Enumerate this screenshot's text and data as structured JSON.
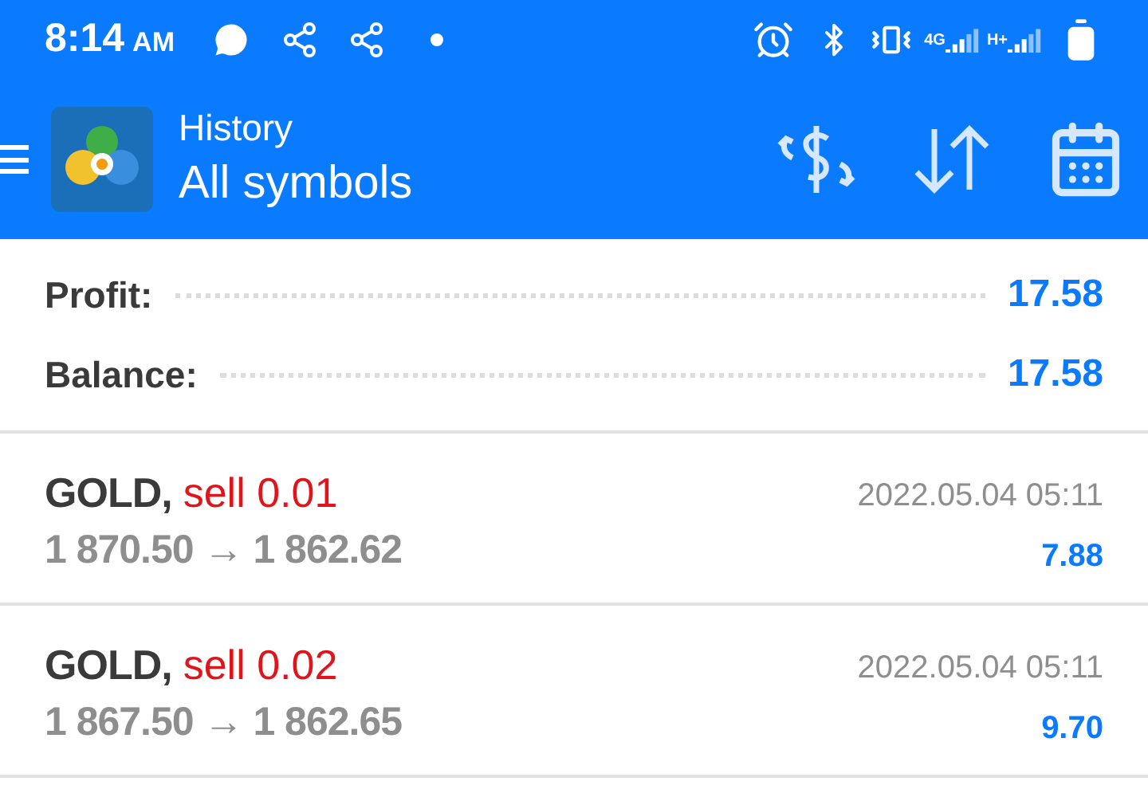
{
  "status_bar": {
    "time": "8:14",
    "ampm": "AM",
    "network_1": "4G",
    "network_2": "H+"
  },
  "header": {
    "title": "History",
    "subtitle": "All symbols"
  },
  "summary": [
    {
      "label": "Profit:",
      "value": "17.58"
    },
    {
      "label": "Balance:",
      "value": "17.58"
    }
  ],
  "deals": [
    {
      "symbol": "GOLD,",
      "kind": "sell",
      "action": "sell 0.01",
      "prices": "1 870.50 → 1 862.62",
      "time": "2022.05.04 05:11",
      "profit": "7.88"
    },
    {
      "symbol": "GOLD,",
      "kind": "sell",
      "action": "sell 0.02",
      "prices": "1 867.50 → 1 862.65",
      "time": "2022.05.04 05:11",
      "profit": "9.70"
    }
  ]
}
